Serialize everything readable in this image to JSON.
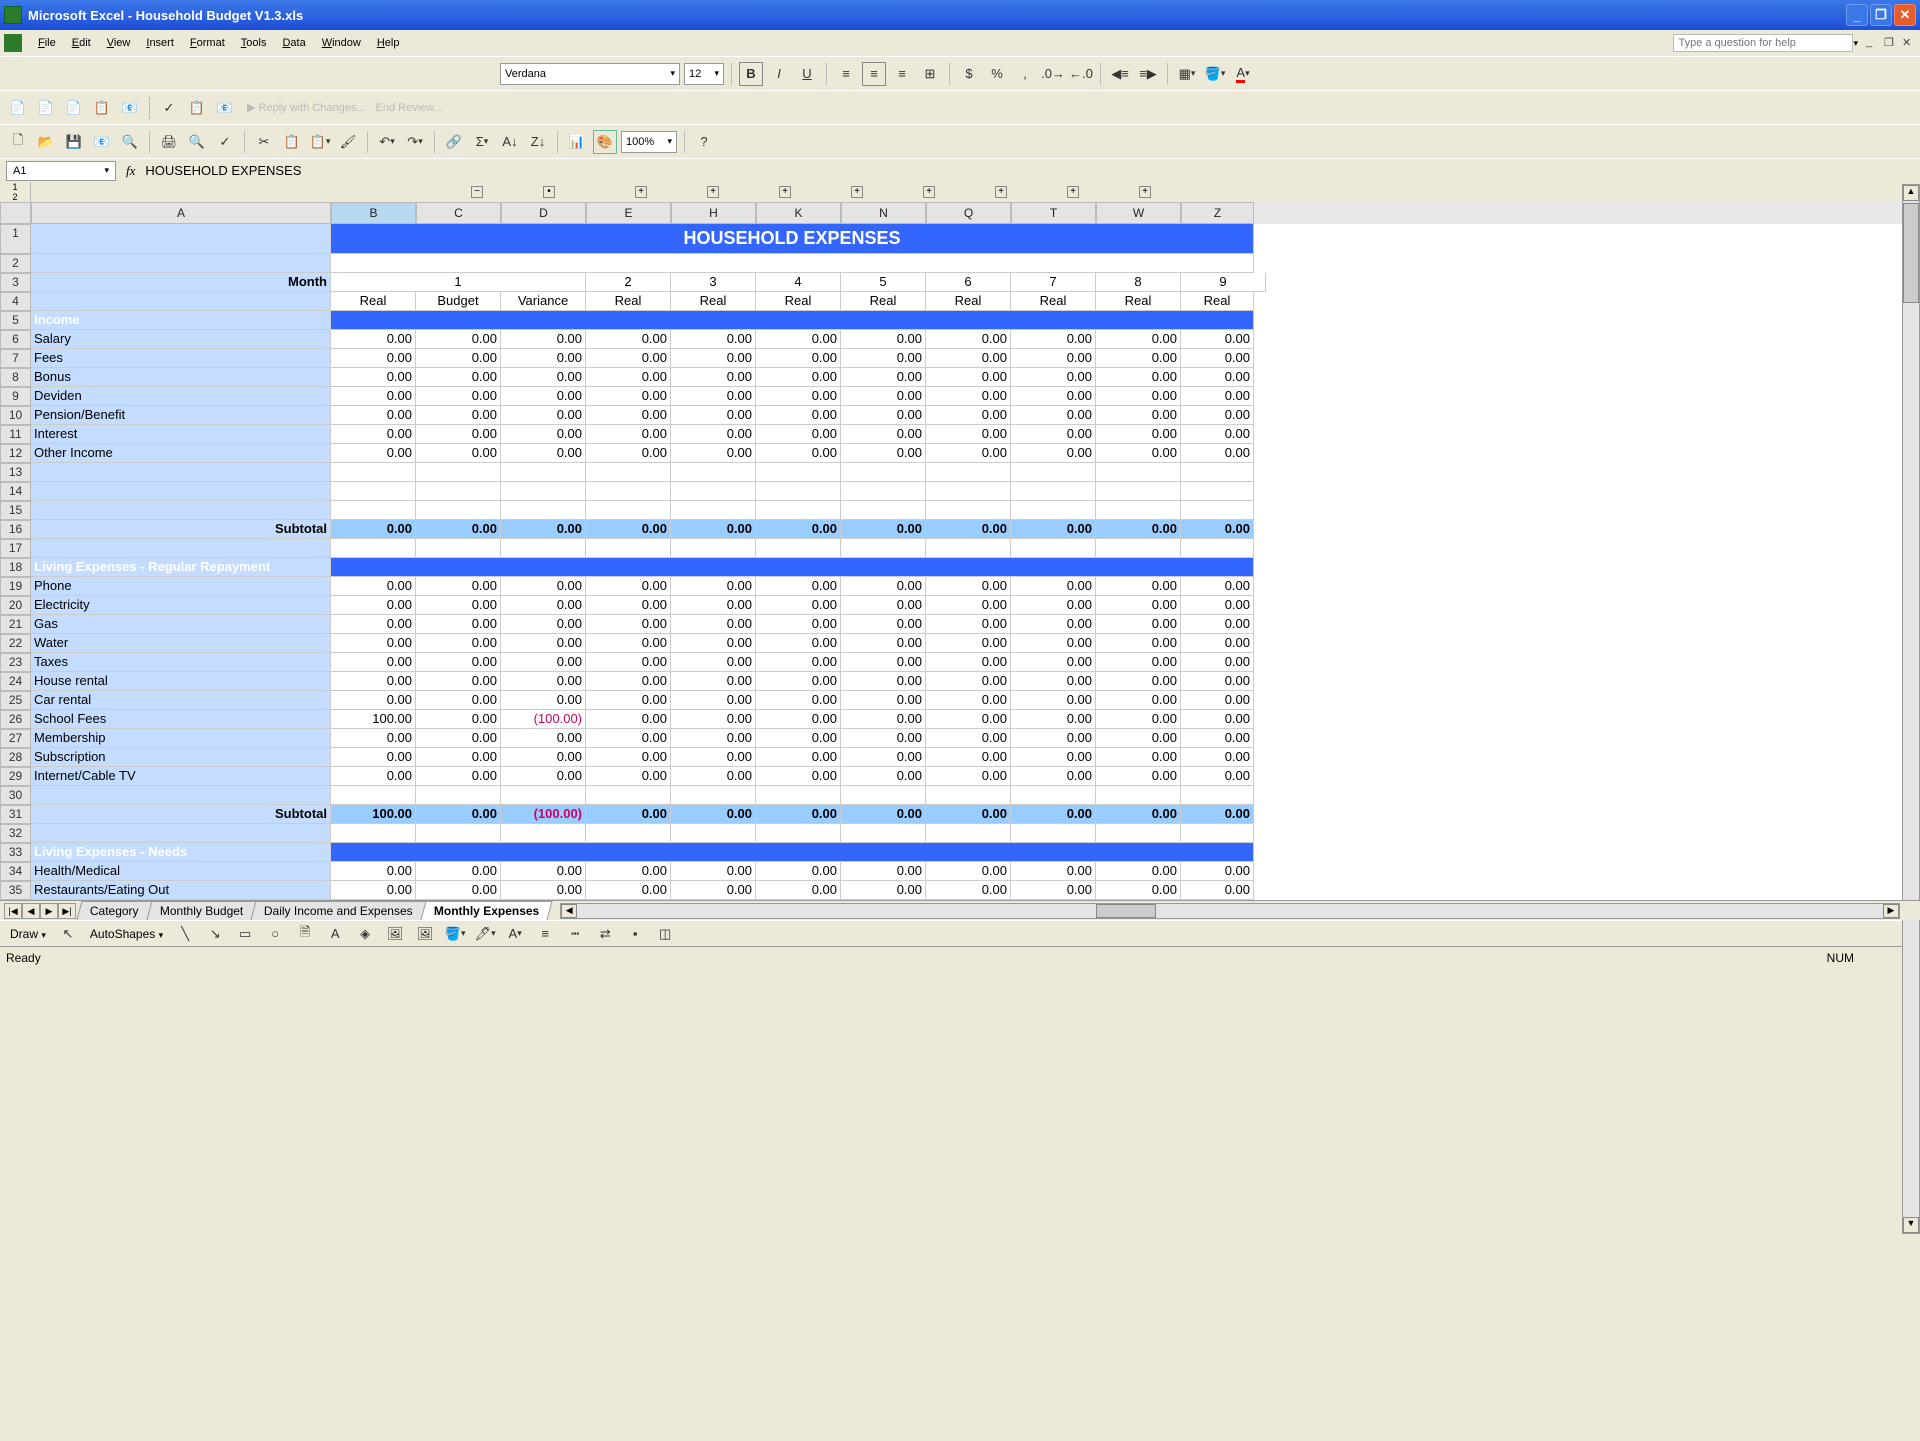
{
  "window": {
    "title": "Microsoft Excel - Household Budget V1.3.xls"
  },
  "menu": {
    "items": [
      "File",
      "Edit",
      "View",
      "Insert",
      "Format",
      "Tools",
      "Data",
      "Window",
      "Help"
    ],
    "question_placeholder": "Type a question for help"
  },
  "formatbar": {
    "font": "Verdana",
    "size": "12"
  },
  "stdbar": {
    "zoom": "100%"
  },
  "namebox": {
    "ref": "A1",
    "formula": "HOUSEHOLD EXPENSES"
  },
  "outline": {
    "levels": [
      "1",
      "2"
    ]
  },
  "columns": [
    "A",
    "B",
    "C",
    "D",
    "E",
    "H",
    "K",
    "N",
    "Q",
    "T",
    "W",
    "Z"
  ],
  "header_title": "HOUSEHOLD EXPENSES",
  "month_label": "Month",
  "months": [
    "1",
    "2",
    "3",
    "4",
    "5",
    "6",
    "7",
    "8",
    "9"
  ],
  "subheaders": [
    "Real",
    "Budget",
    "Variance",
    "Real",
    "Real",
    "Real",
    "Real",
    "Real",
    "Real",
    "Real",
    "Real"
  ],
  "sections": [
    {
      "row": 5,
      "title": "Income",
      "items": [
        {
          "row": 6,
          "label": "Salary",
          "values": [
            "0.00",
            "0.00",
            "0.00",
            "0.00",
            "0.00",
            "0.00",
            "0.00",
            "0.00",
            "0.00",
            "0.00",
            "0.00"
          ]
        },
        {
          "row": 7,
          "label": "Fees",
          "values": [
            "0.00",
            "0.00",
            "0.00",
            "0.00",
            "0.00",
            "0.00",
            "0.00",
            "0.00",
            "0.00",
            "0.00",
            "0.00"
          ]
        },
        {
          "row": 8,
          "label": "Bonus",
          "values": [
            "0.00",
            "0.00",
            "0.00",
            "0.00",
            "0.00",
            "0.00",
            "0.00",
            "0.00",
            "0.00",
            "0.00",
            "0.00"
          ]
        },
        {
          "row": 9,
          "label": "Deviden",
          "values": [
            "0.00",
            "0.00",
            "0.00",
            "0.00",
            "0.00",
            "0.00",
            "0.00",
            "0.00",
            "0.00",
            "0.00",
            "0.00"
          ]
        },
        {
          "row": 10,
          "label": "Pension/Benefit",
          "values": [
            "0.00",
            "0.00",
            "0.00",
            "0.00",
            "0.00",
            "0.00",
            "0.00",
            "0.00",
            "0.00",
            "0.00",
            "0.00"
          ]
        },
        {
          "row": 11,
          "label": "Interest",
          "values": [
            "0.00",
            "0.00",
            "0.00",
            "0.00",
            "0.00",
            "0.00",
            "0.00",
            "0.00",
            "0.00",
            "0.00",
            "0.00"
          ]
        },
        {
          "row": 12,
          "label": "Other Income",
          "values": [
            "0.00",
            "0.00",
            "0.00",
            "0.00",
            "0.00",
            "0.00",
            "0.00",
            "0.00",
            "0.00",
            "0.00",
            "0.00"
          ]
        }
      ],
      "blank_rows": [
        13,
        14,
        15
      ],
      "subtotal_row": 16,
      "subtotal_label": "Subtotal",
      "subtotal": [
        "0.00",
        "0.00",
        "0.00",
        "0.00",
        "0.00",
        "0.00",
        "0.00",
        "0.00",
        "0.00",
        "0.00",
        "0.00"
      ],
      "tail_blank": [
        17
      ]
    },
    {
      "row": 18,
      "title": "Living Expenses - Regular Repayment",
      "items": [
        {
          "row": 19,
          "label": "Phone",
          "values": [
            "0.00",
            "0.00",
            "0.00",
            "0.00",
            "0.00",
            "0.00",
            "0.00",
            "0.00",
            "0.00",
            "0.00",
            "0.00"
          ]
        },
        {
          "row": 20,
          "label": "Electricity",
          "values": [
            "0.00",
            "0.00",
            "0.00",
            "0.00",
            "0.00",
            "0.00",
            "0.00",
            "0.00",
            "0.00",
            "0.00",
            "0.00"
          ]
        },
        {
          "row": 21,
          "label": "Gas",
          "values": [
            "0.00",
            "0.00",
            "0.00",
            "0.00",
            "0.00",
            "0.00",
            "0.00",
            "0.00",
            "0.00",
            "0.00",
            "0.00"
          ]
        },
        {
          "row": 22,
          "label": "Water",
          "values": [
            "0.00",
            "0.00",
            "0.00",
            "0.00",
            "0.00",
            "0.00",
            "0.00",
            "0.00",
            "0.00",
            "0.00",
            "0.00"
          ]
        },
        {
          "row": 23,
          "label": "Taxes",
          "values": [
            "0.00",
            "0.00",
            "0.00",
            "0.00",
            "0.00",
            "0.00",
            "0.00",
            "0.00",
            "0.00",
            "0.00",
            "0.00"
          ]
        },
        {
          "row": 24,
          "label": "House rental",
          "values": [
            "0.00",
            "0.00",
            "0.00",
            "0.00",
            "0.00",
            "0.00",
            "0.00",
            "0.00",
            "0.00",
            "0.00",
            "0.00"
          ]
        },
        {
          "row": 25,
          "label": "Car rental",
          "values": [
            "0.00",
            "0.00",
            "0.00",
            "0.00",
            "0.00",
            "0.00",
            "0.00",
            "0.00",
            "0.00",
            "0.00",
            "0.00"
          ]
        },
        {
          "row": 26,
          "label": "School Fees",
          "values": [
            "100.00",
            "0.00",
            "(100.00)",
            "0.00",
            "0.00",
            "0.00",
            "0.00",
            "0.00",
            "0.00",
            "0.00",
            "0.00"
          ],
          "neg_idx": [
            2
          ]
        },
        {
          "row": 27,
          "label": "Membership",
          "values": [
            "0.00",
            "0.00",
            "0.00",
            "0.00",
            "0.00",
            "0.00",
            "0.00",
            "0.00",
            "0.00",
            "0.00",
            "0.00"
          ]
        },
        {
          "row": 28,
          "label": "Subscription",
          "values": [
            "0.00",
            "0.00",
            "0.00",
            "0.00",
            "0.00",
            "0.00",
            "0.00",
            "0.00",
            "0.00",
            "0.00",
            "0.00"
          ]
        },
        {
          "row": 29,
          "label": "Internet/Cable TV",
          "values": [
            "0.00",
            "0.00",
            "0.00",
            "0.00",
            "0.00",
            "0.00",
            "0.00",
            "0.00",
            "0.00",
            "0.00",
            "0.00"
          ]
        }
      ],
      "blank_rows": [
        30
      ],
      "subtotal_row": 31,
      "subtotal_label": "Subtotal",
      "subtotal": [
        "100.00",
        "0.00",
        "(100.00)",
        "0.00",
        "0.00",
        "0.00",
        "0.00",
        "0.00",
        "0.00",
        "0.00",
        "0.00"
      ],
      "subtotal_neg_idx": [
        2
      ],
      "tail_blank": [
        32
      ]
    },
    {
      "row": 33,
      "title": "Living Expenses - Needs",
      "items": [
        {
          "row": 34,
          "label": "Health/Medical",
          "values": [
            "0.00",
            "0.00",
            "0.00",
            "0.00",
            "0.00",
            "0.00",
            "0.00",
            "0.00",
            "0.00",
            "0.00",
            "0.00"
          ]
        },
        {
          "row": 35,
          "label": "Restaurants/Eating Out",
          "values": [
            "0.00",
            "0.00",
            "0.00",
            "0.00",
            "0.00",
            "0.00",
            "0.00",
            "0.00",
            "0.00",
            "0.00",
            "0.00"
          ]
        }
      ]
    }
  ],
  "tabs": {
    "list": [
      "Category",
      "Monthly Budget",
      "Daily Income and Expenses",
      "Monthly Expenses"
    ],
    "active": 3
  },
  "draw": {
    "label": "Draw",
    "autoshapes": "AutoShapes"
  },
  "status": {
    "left": "Ready",
    "right": "NUM"
  }
}
